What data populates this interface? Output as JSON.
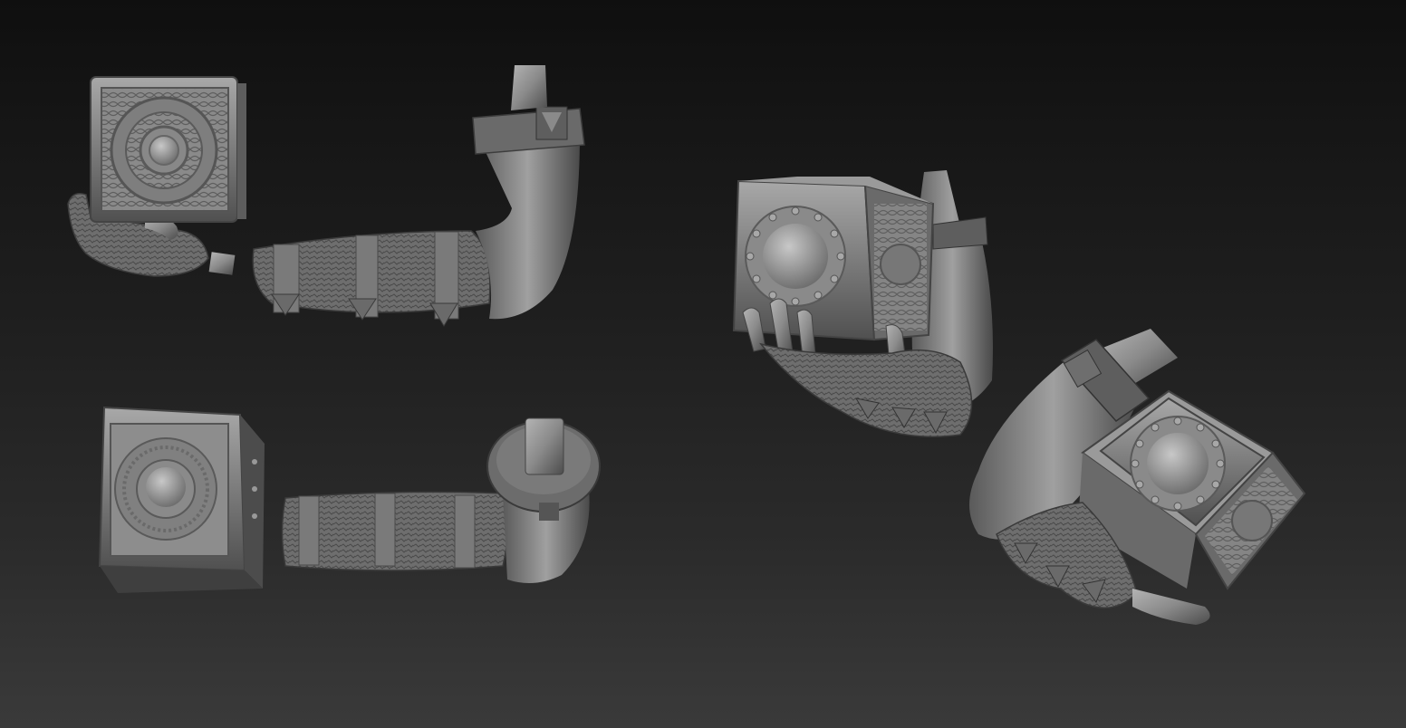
{
  "scene": {
    "background_top": "#0f0f0f",
    "background_bottom": "#3a3a3a",
    "material_color": "#8c8c8c",
    "objects": [
      {
        "name": "arm-with-box-top-left"
      },
      {
        "name": "arm-with-box-bottom-left"
      },
      {
        "name": "arm-holding-box-right-upper"
      },
      {
        "name": "arm-holding-box-right-lower"
      }
    ]
  }
}
